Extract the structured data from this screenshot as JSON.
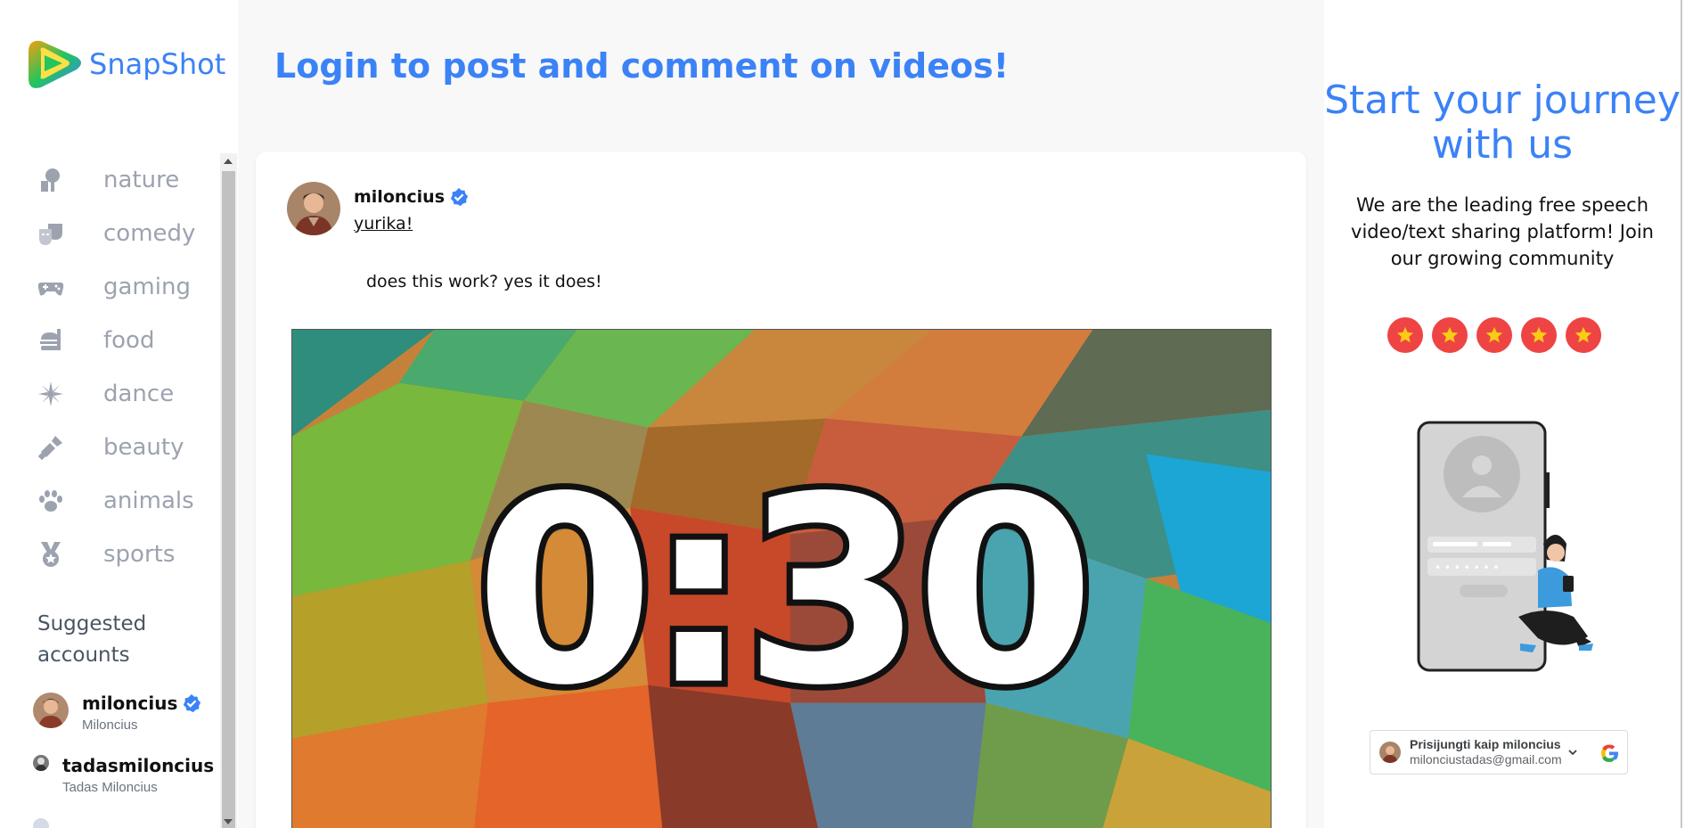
{
  "app": {
    "name": "SnapShot"
  },
  "sidebar": {
    "categories": [
      {
        "label": "nature",
        "icon": "tree-icon"
      },
      {
        "label": "comedy",
        "icon": "theater-masks-icon"
      },
      {
        "label": "gaming",
        "icon": "gamepad-icon"
      },
      {
        "label": "food",
        "icon": "burger-icon"
      },
      {
        "label": "dance",
        "icon": "disco-ball-icon"
      },
      {
        "label": "beauty",
        "icon": "lipstick-icon"
      },
      {
        "label": "animals",
        "icon": "paw-icon"
      },
      {
        "label": "sports",
        "icon": "medal-icon"
      }
    ],
    "suggested_title": "Suggested accounts",
    "accounts": [
      {
        "username": "miloncius",
        "display_name": "Miloncius"
      },
      {
        "username": "tadasmiloncius",
        "display_name": "Tadas Miloncius"
      }
    ]
  },
  "main": {
    "title": "Login to post and comment on videos!",
    "post": {
      "username": "miloncius",
      "topic": "yurika!",
      "caption": "does this work? yes it does!",
      "video_text": "0:30"
    }
  },
  "right": {
    "title": "Start your journey with us",
    "description": "We are the leading free speech video/text sharing platform! Join our growing community",
    "rating": 5,
    "google_signin": {
      "label": "Prisijungti kaip miloncius",
      "email": "milonciustadas@gmail.com"
    }
  },
  "colors": {
    "accent": "#3b82f6",
    "star": "#ef4444",
    "muted": "#9ca3af"
  }
}
